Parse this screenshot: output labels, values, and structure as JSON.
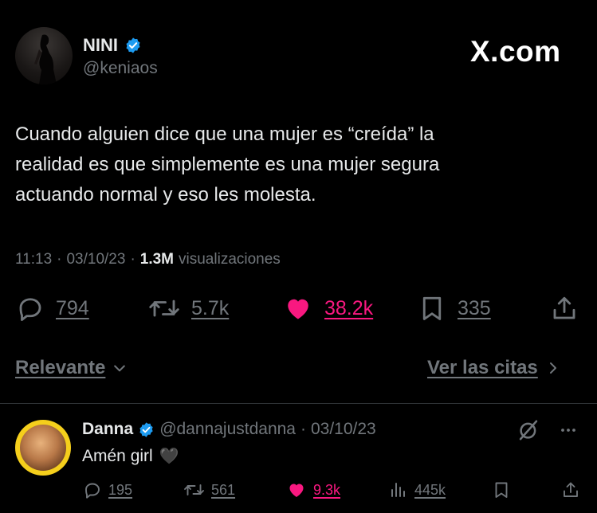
{
  "brand": {
    "logo_text": "X.com",
    "verified_color": "#1d9bf0",
    "like_color": "#f91880"
  },
  "tweet": {
    "author_name": "NINI",
    "handle": "@keniaos",
    "text_lines": [
      "Cuando alguien dice que una mujer es “creída” la",
      "realidad es que simplemente es una mujer segura",
      "actuando normal y eso les molesta."
    ],
    "time": "11:13",
    "date": "03/10/23",
    "views_count": "1.3M",
    "views_label": "visualizaciones",
    "stats": {
      "replies": "794",
      "retweets": "5.7k",
      "likes": "38.2k",
      "bookmarks": "335"
    }
  },
  "sort": {
    "relevant_label": "Relevante",
    "quotes_label": "Ver las citas"
  },
  "reply": {
    "author_name": "Danna",
    "handle": "@dannajustdanna",
    "date": "03/10/23",
    "text": "Amén girl",
    "emoji": "🖤",
    "stats": {
      "replies": "195",
      "retweets": "561",
      "likes": "9.3k",
      "views": "445k"
    }
  },
  "icons": [
    "verified-badge-icon",
    "reply-icon",
    "retweet-icon",
    "heart-icon",
    "bookmark-icon",
    "share-icon",
    "grok-icon",
    "more-icon",
    "views-icon"
  ]
}
